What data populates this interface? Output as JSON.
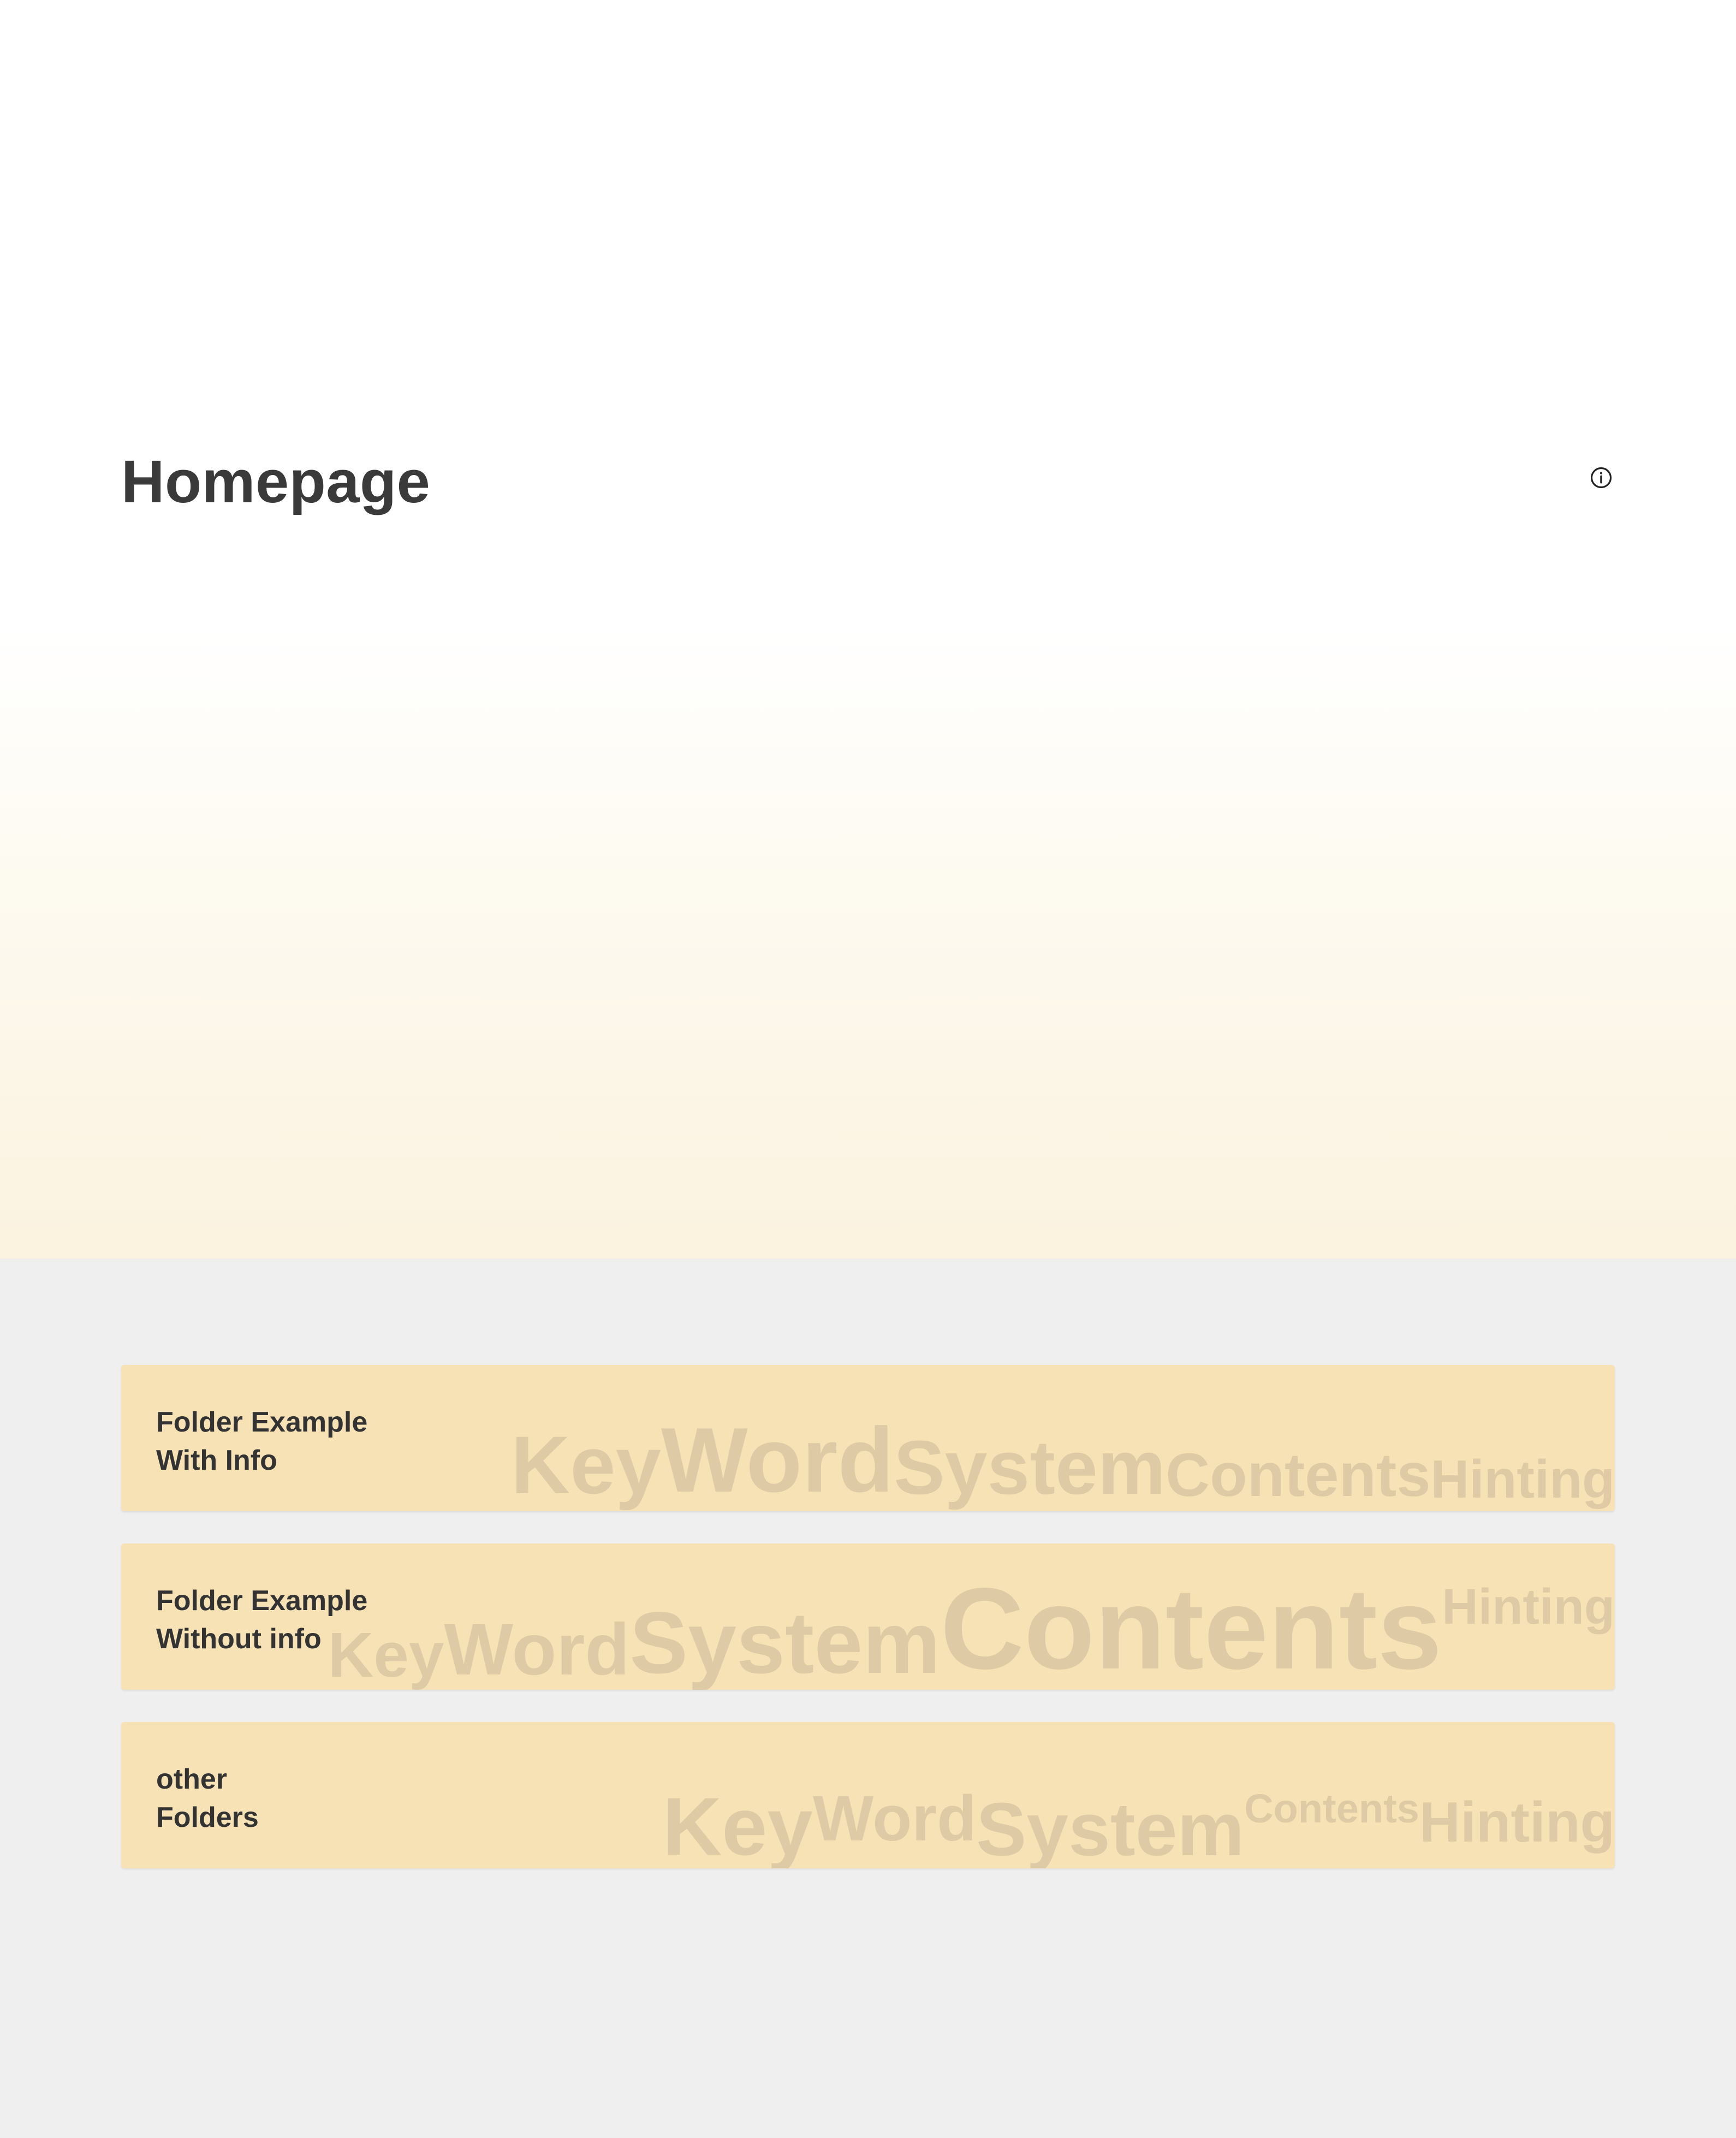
{
  "header": {
    "title": "Homepage",
    "info_icon": "info-icon"
  },
  "folders": [
    {
      "line1": "Folder Example",
      "line2": "With Info",
      "keywords": [
        "Key",
        "Word",
        "System",
        "Contents",
        "Hinting"
      ]
    },
    {
      "line1": "Folder Example",
      "line2": "Without info",
      "keywords": [
        "Key",
        "Word",
        "System",
        "Contents",
        "Hinting"
      ]
    },
    {
      "line1": "other",
      "line2": "Folders",
      "keywords": [
        "Key",
        "Word",
        "System",
        "Contents",
        "Hinting"
      ]
    }
  ],
  "colors": {
    "background": "#efefef",
    "card": "#f7e2b5",
    "title_text": "#3a3a3a",
    "card_text": "#333333"
  }
}
